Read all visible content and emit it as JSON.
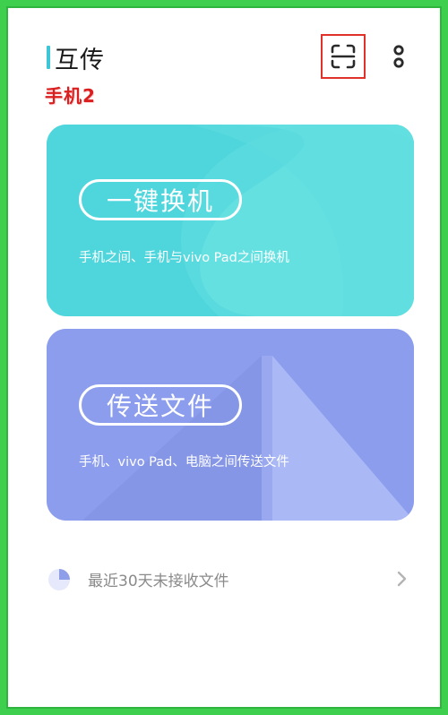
{
  "header": {
    "title": "互传",
    "device_tag": "手机2",
    "scan_icon": "scan-icon",
    "more_icon": "more-vertical-icon"
  },
  "cards": {
    "switch": {
      "title": "一键换机",
      "description": "手机之间、手机与vivo Pad之间换机",
      "color": "#4fd6dc"
    },
    "transfer": {
      "title": "传送文件",
      "description": "手机、vivo Pad、电脑之间传送文件",
      "color": "#8c9ded"
    }
  },
  "recent": {
    "label": "最近30天未接收文件",
    "icon": "pie-clock-icon"
  },
  "colors": {
    "accent": "#3ec6d6",
    "annotation_red": "#d91f1f",
    "frame_green": "#3fcf4f"
  }
}
